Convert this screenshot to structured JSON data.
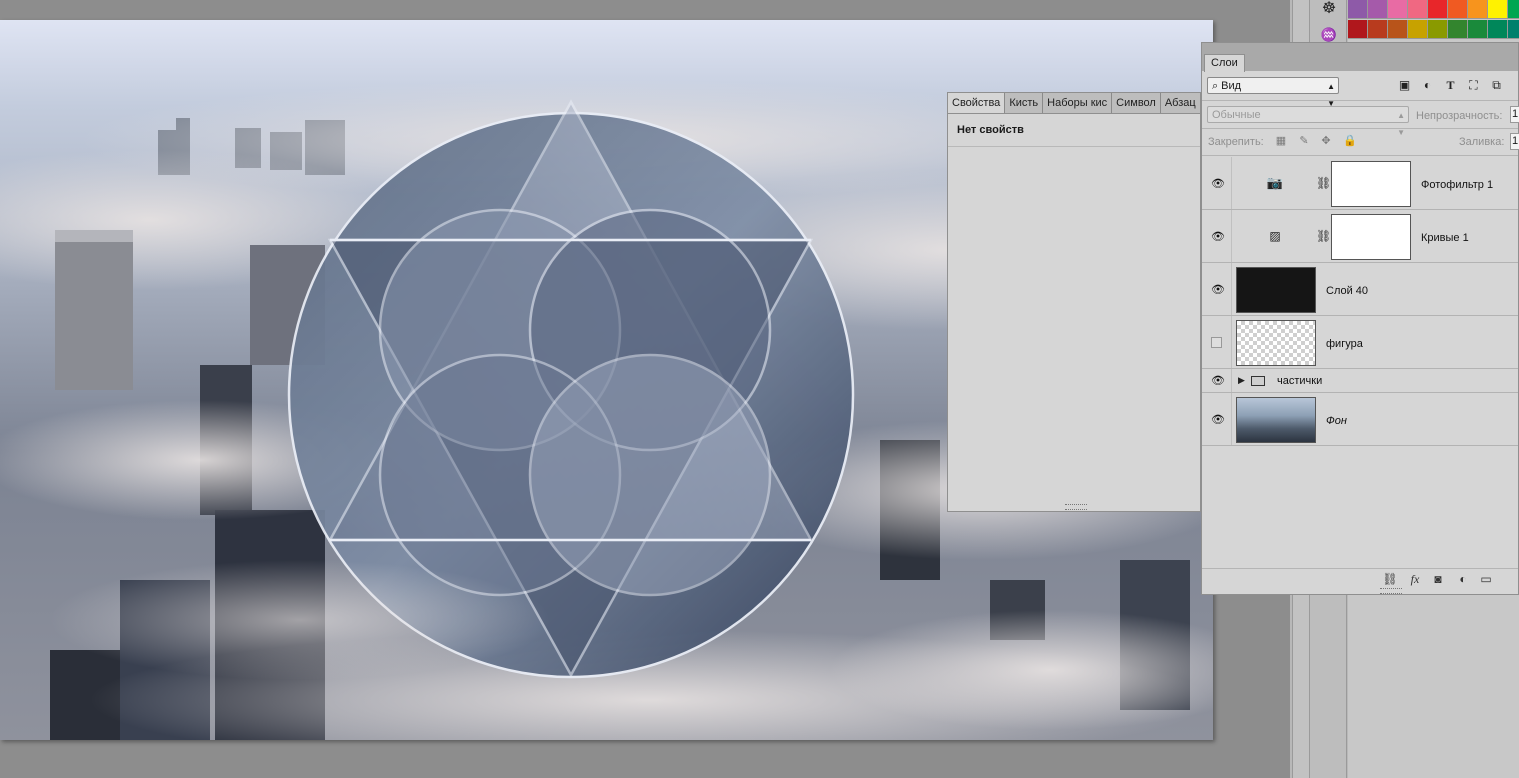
{
  "app": {
    "accent": "#d6d6d6"
  },
  "properties_panel": {
    "tabs": [
      "Свойства",
      "Кисть",
      "Наборы кис",
      "Символ",
      "Абзац"
    ],
    "active_tab": "Свойства",
    "body_text": "Нет свойств"
  },
  "layers_panel": {
    "tab_label": "Слои",
    "filter": {
      "value": "Вид",
      "icons": [
        "image-filter-icon",
        "adjustment-filter-icon",
        "type-filter-icon",
        "shape-filter-icon",
        "smart-object-filter-icon"
      ]
    },
    "blend_mode": "Обычные",
    "opacity_label": "Непрозрачность:",
    "opacity_value": "1",
    "lock_label": "Закрепить:",
    "fill_label": "Заливка:",
    "fill_value": "1",
    "layers": [
      {
        "name": "Фотофильтр 1",
        "visible": true,
        "kind": "photo-filter"
      },
      {
        "name": "Кривые 1",
        "visible": true,
        "kind": "curves"
      },
      {
        "name": "Слой 40",
        "visible": true,
        "kind": "pixel-dark"
      },
      {
        "name": "фигура",
        "visible": false,
        "kind": "pixel-transparent"
      },
      {
        "name": "частички",
        "visible": true,
        "kind": "group"
      },
      {
        "name": "Фон",
        "visible": true,
        "kind": "background"
      }
    ]
  },
  "swatches": [
    "#8e5aa8",
    "#a55aaa",
    "#e86ba4",
    "#f06882",
    "#e8262a",
    "#f05a22",
    "#f7941d",
    "#fff200",
    "#00a651",
    "#b0171c",
    "#b83b1e",
    "#b8541a",
    "#c7a200",
    "#8a9a00",
    "#33852e",
    "#1a8a3b",
    "#00875a",
    "#00806c"
  ],
  "dock_icons": [
    "ship-wheel-icon",
    "brush-presets-icon"
  ]
}
